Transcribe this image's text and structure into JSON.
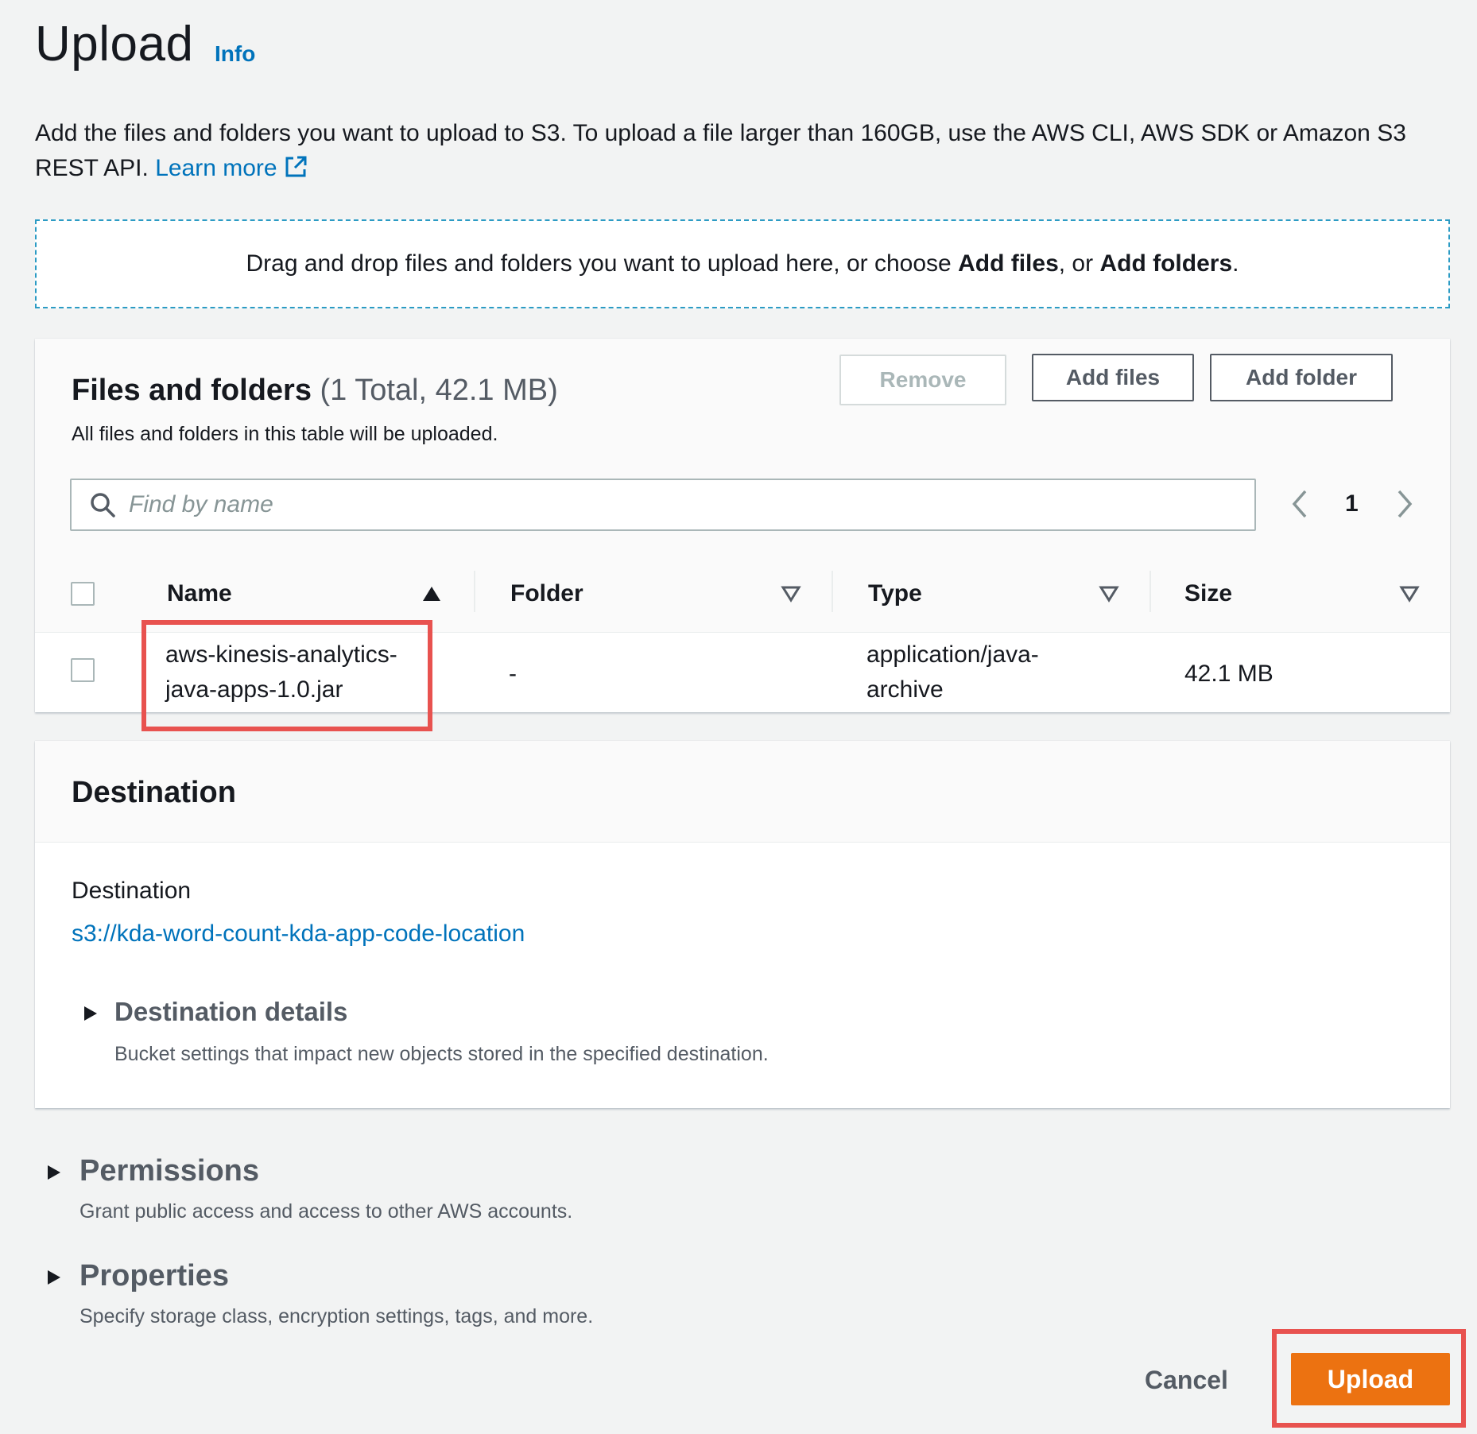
{
  "header": {
    "title": "Upload",
    "info_label": "Info",
    "description": "Add the files and folders you want to upload to S3. To upload a file larger than 160GB, use the AWS CLI, AWS SDK or Amazon S3 REST API.",
    "learn_more": "Learn more"
  },
  "dropzone": {
    "text_prefix": "Drag and drop files and folders you want to upload here, or choose",
    "add_files": "Add files",
    "separator": ", or",
    "add_folders": "Add folders",
    "suffix": "."
  },
  "files_panel": {
    "title": "Files and folders",
    "count": "(1 Total, 42.1 MB)",
    "subtitle": "All files and folders in this table will be uploaded.",
    "remove_label": "Remove",
    "add_files_label": "Add files",
    "add_folder_label": "Add folder",
    "search_placeholder": "Find by name",
    "page": "1",
    "columns": [
      "Name",
      "Folder",
      "Type",
      "Size"
    ],
    "rows": [
      {
        "name": "aws-kinesis-analytics-java-apps-1.0.jar",
        "folder": "-",
        "type": "application/java-archive",
        "size": "42.1 MB"
      }
    ]
  },
  "destination": {
    "title": "Destination",
    "label": "Destination",
    "url": "s3://kda-word-count-kda-app-code-location",
    "details_title": "Destination details",
    "details_sub": "Bucket settings that impact new objects stored in the specified destination."
  },
  "permissions": {
    "title": "Permissions",
    "sub": "Grant public access and access to other AWS accounts."
  },
  "properties": {
    "title": "Properties",
    "sub": "Specify storage class, encryption settings, tags, and more."
  },
  "footer": {
    "cancel_label": "Cancel",
    "upload_label": "Upload"
  },
  "colors": {
    "link": "#0073bb",
    "primary": "#ec7211",
    "highlight": "#e8524f"
  }
}
